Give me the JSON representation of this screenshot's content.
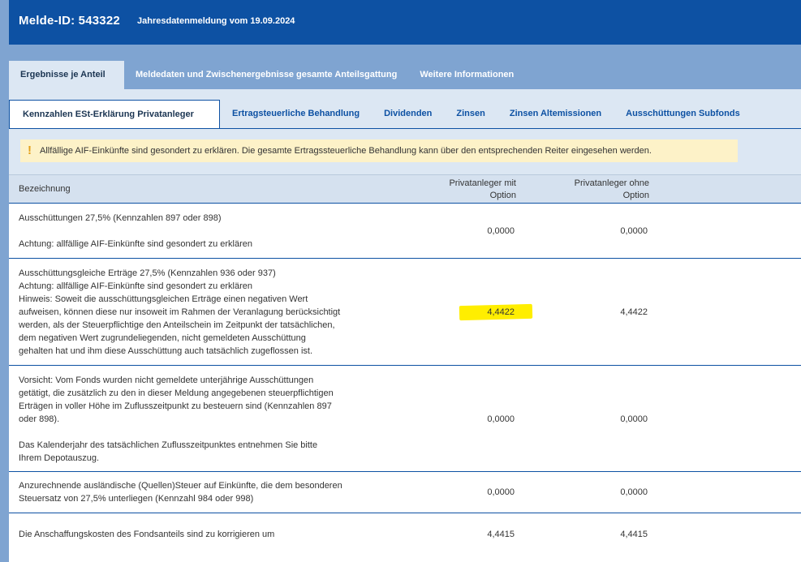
{
  "header": {
    "melde_id": "Melde-ID: 543322",
    "subtitle": "Jahresdatenmeldung vom 19.09.2024"
  },
  "top_tabs": [
    {
      "label": "Ergebnisse je Anteil",
      "active": true
    },
    {
      "label": "Meldedaten und Zwischenergebnisse gesamte Anteilsgattung",
      "active": false
    },
    {
      "label": "Weitere Informationen",
      "active": false
    }
  ],
  "sub_tabs": [
    {
      "label": "Kennzahlen ESt-Erklärung Privatanleger",
      "active": true
    },
    {
      "label": "Ertragsteuerliche Behandlung",
      "active": false
    },
    {
      "label": "Dividenden",
      "active": false
    },
    {
      "label": "Zinsen",
      "active": false
    },
    {
      "label": "Zinsen Altemissionen",
      "active": false
    },
    {
      "label": "Ausschüttungen Subfonds",
      "active": false
    }
  ],
  "warning": {
    "icon": "exclamation-icon",
    "text": "Allfällige AIF-Einkünfte sind gesondert zu erklären. Die gesamte Ertragssteuerliche Behandlung kann über den entsprechenden Reiter eingesehen werden."
  },
  "table": {
    "headers": {
      "bezeichnung": "Bezeichnung",
      "mit_option_1": "Privatanleger mit",
      "mit_option_2": "Option",
      "ohne_option_1": "Privatanleger ohne",
      "ohne_option_2": "Option"
    },
    "rows": [
      {
        "lines": [
          "Ausschüttungen 27,5% (Kennzahlen 897 oder 898)",
          "",
          "Achtung: allfällige AIF-Einkünfte sind gesondert zu erklären"
        ],
        "mit": "0,0000",
        "ohne": "0,0000",
        "highlight": false
      },
      {
        "lines": [
          "Ausschüttungsgleiche Erträge 27,5% (Kennzahlen 936 oder 937)",
          "Achtung: allfällige AIF-Einkünfte sind gesondert zu erklären",
          "Hinweis: Soweit die ausschüttungsgleichen Erträge einen negativen Wert",
          "aufweisen, können diese nur insoweit im Rahmen der Veranlagung berücksichtigt",
          "werden, als der Steuerpflichtige den Anteilschein im Zeitpunkt der tatsächlichen,",
          "dem negativen Wert zugrundeliegenden, nicht gemeldeten Ausschüttung",
          "gehalten hat und ihm diese Ausschüttung auch tatsächlich zugeflossen ist."
        ],
        "mit": "4,4422",
        "ohne": "4,4422",
        "highlight": true,
        "highlight_color": "#ffee00"
      },
      {
        "lines": [
          "Vorsicht: Vom Fonds wurden nicht gemeldete unterjährige Ausschüttungen",
          "getätigt, die zusätzlich zu den in dieser Meldung angegebenen steuerpflichtigen",
          "Erträgen in voller Höhe im Zuflusszeitpunkt zu besteuern sind (Kennzahlen 897",
          "oder 898).",
          "",
          "Das Kalenderjahr des tatsächlichen Zuflusszeitpunktes entnehmen Sie bitte",
          "Ihrem Depotauszug."
        ],
        "mit": "0,0000",
        "ohne": "0,0000",
        "highlight": false
      },
      {
        "lines": [
          "Anzurechnende ausländische (Quellen)Steuer auf Einkünfte, die dem besonderen",
          "Steuersatz von 27,5% unterliegen (Kennzahl 984 oder 998)"
        ],
        "mit": "0,0000",
        "ohne": "0,0000",
        "highlight": false
      },
      {
        "lines": [
          "Die Anschaffungskosten des Fondsanteils sind zu korrigieren um"
        ],
        "mit": "4,4415",
        "ohne": "4,4415",
        "highlight": false
      }
    ]
  }
}
